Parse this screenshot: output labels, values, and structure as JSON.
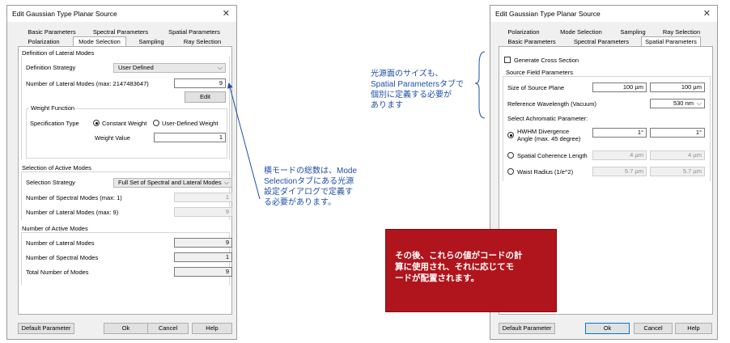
{
  "left_dialog": {
    "title": "Edit Gaussian Type Planar Source",
    "close_glyph": "✕",
    "tabs_row1": [
      "Basic Parameters",
      "Spectral Parameters",
      "Spatial Parameters"
    ],
    "tabs_row2": [
      "Polarization",
      "Mode Selection",
      "Sampling",
      "Ray Selection"
    ],
    "lateral": {
      "group_title": "Definition of Lateral Modes",
      "strategy_label": "Definition Strategy",
      "strategy_value": "User Defined",
      "num_label": "Number of Lateral Modes (max: 2147483647)",
      "num_value": "9",
      "edit_button": "Edit",
      "weight": {
        "group_title": "Weight Function",
        "spec_label": "Specification Type",
        "opt_constant": "Constant Weight",
        "opt_user": "User-Defined Weight",
        "value_label": "Weight Value",
        "value": "1"
      }
    },
    "active": {
      "group_title": "Selection of Active Modes",
      "strategy_label": "Selection Strategy",
      "strategy_value": "Full Set of Spectral and Lateral Modes",
      "spectral_label": "Number of Spectral Modes (max: 1)",
      "spectral_value": "1",
      "lateral_label": "Number of Lateral Modes (max: 9)",
      "lateral_value": "9"
    },
    "count": {
      "group_title": "Number of Active Modes",
      "lateral_label": "Number of Lateral Modes",
      "lateral_value": "9",
      "spectral_label": "Number of Spectral Modes",
      "spectral_value": "1",
      "total_label": "Total Number of Modes",
      "total_value": "9"
    },
    "buttons": {
      "default": "Default Parameter",
      "ok": "Ok",
      "cancel": "Cancel",
      "help": "Help"
    }
  },
  "right_dialog": {
    "title": "Edit Gaussian Type Planar Source",
    "close_glyph": "✕",
    "tabs_row1": [
      "Polarization",
      "Mode Selection",
      "Sampling",
      "Ray Selection"
    ],
    "tabs_row2": [
      "Basic Parameters",
      "Spectral Parameters",
      "Spatial Parameters"
    ],
    "generate_cross_section": "Generate Cross Section",
    "source_field": {
      "group_title": "Source Field Parameters",
      "size_label": "Size of Source Plane",
      "size_x": "100 µm",
      "size_y": "100 µm",
      "wavelength_label": "Reference Wavelength (Vacuum)",
      "wavelength_value": "530 nm",
      "achromatic_label": "Select Achromatic Parameter:",
      "hwhm_line1": "HWHM Divergence",
      "hwhm_line2": "Angle (max. 45 degree)",
      "hwhm_x": "1°",
      "hwhm_y": "1°",
      "coherence_label": "Spatial Coherence Length",
      "coherence_x": "4 µm",
      "coherence_y": "4 µm",
      "waist_label": "Waist Radius (1/e^2)",
      "waist_x": "5.7 µm",
      "waist_y": "5.7 µm"
    },
    "buttons": {
      "default": "Default Parameter",
      "ok": "Ok",
      "cancel": "Cancel",
      "help": "Help"
    }
  },
  "annotations": {
    "mode_note": [
      "横モードの総数は、Mode",
      "Selectionタブにある光源",
      "設定ダイアログで定義す",
      "る必要があります。"
    ],
    "size_note": [
      "光源面のサイズも、",
      "Spatial Parametersタブで",
      "個別に定義する必要が",
      "あります"
    ],
    "result_note": [
      "その後、これらの値がコードの計",
      "算に使用され、それに応じてモ",
      "ードが配置されます。"
    ]
  },
  "colors": {
    "annotation_text": "#1f4fa8",
    "callout_fill": "#b0141c",
    "focus_border": "#0078d7"
  }
}
